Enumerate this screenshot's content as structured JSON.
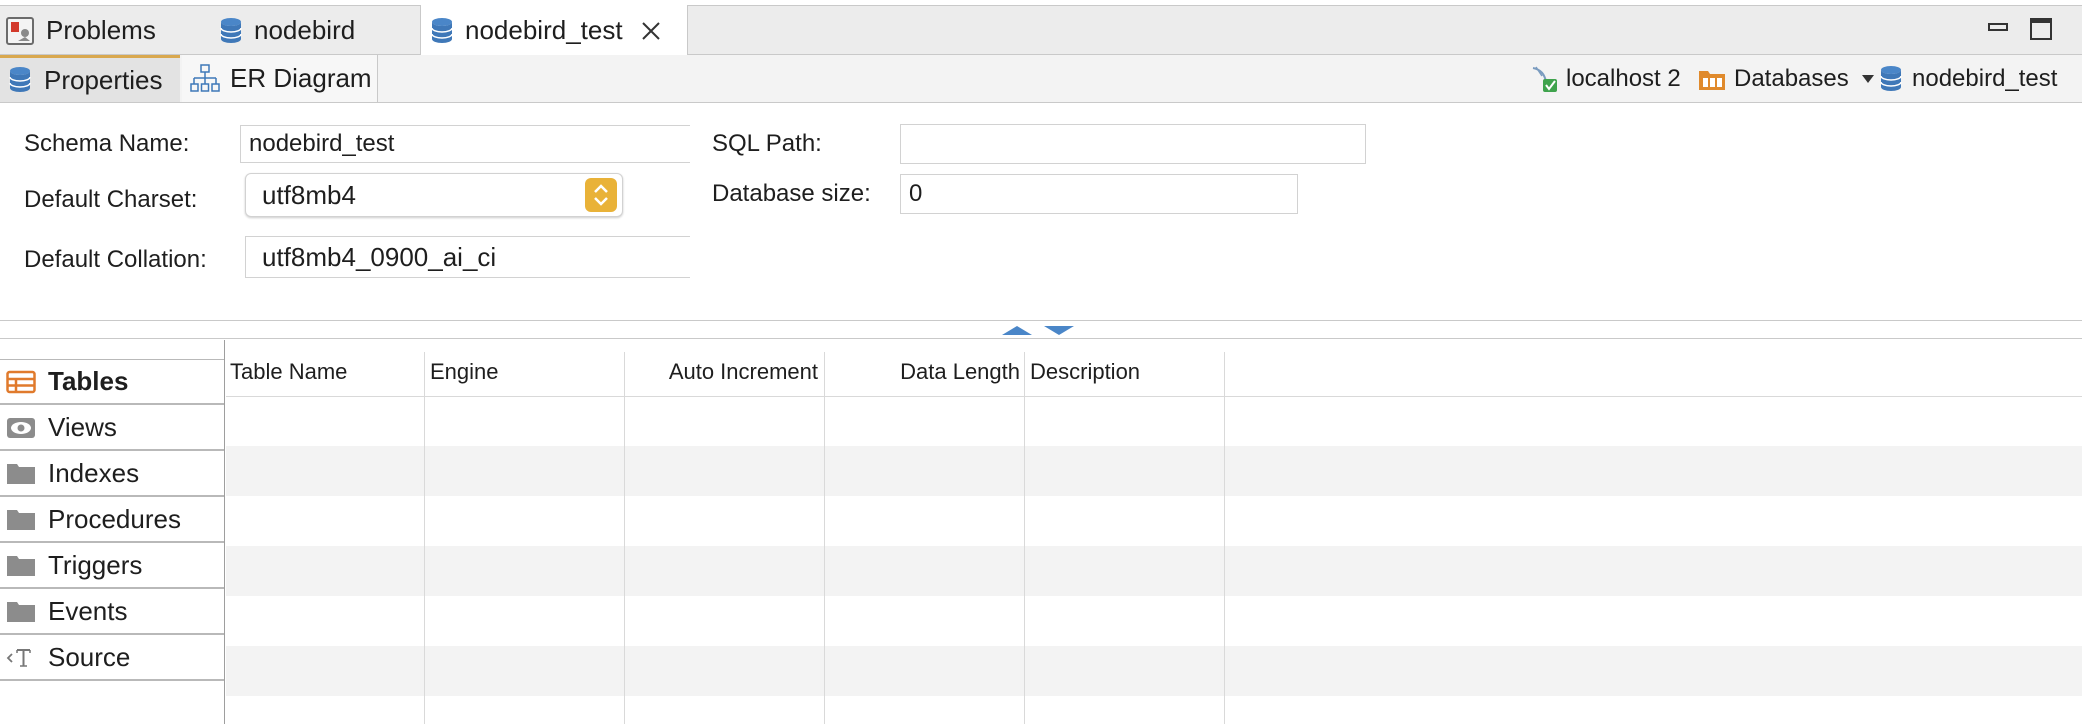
{
  "editor_tabs": [
    {
      "label": "Problems",
      "icon": "problems-icon",
      "active": false
    },
    {
      "label": "nodebird",
      "icon": "database-icon",
      "active": false
    },
    {
      "label": "nodebird_test",
      "icon": "database-icon",
      "active": true,
      "closable": true
    }
  ],
  "sub_tabs": [
    {
      "label": "Properties",
      "icon": "database-icon",
      "active": true
    },
    {
      "label": "ER Diagram",
      "icon": "er-diagram-icon",
      "active": false
    }
  ],
  "breadcrumb": {
    "server": "localhost 2",
    "databases": "Databases",
    "database": "nodebird_test"
  },
  "form": {
    "schema_name_label": "Schema Name:",
    "schema_name_value": "nodebird_test",
    "charset_label": "Default Charset:",
    "charset_value": "utf8mb4",
    "collation_label": "Default Collation:",
    "collation_value": "utf8mb4_0900_ai_ci",
    "sql_path_label": "SQL Path:",
    "sql_path_value": "",
    "db_size_label": "Database size:",
    "db_size_value": "0"
  },
  "nav": [
    {
      "label": "Tables",
      "icon": "table-icon",
      "active": true
    },
    {
      "label": "Views",
      "icon": "eye-icon",
      "active": false
    },
    {
      "label": "Indexes",
      "icon": "folder-icon",
      "active": false
    },
    {
      "label": "Procedures",
      "icon": "folder-icon",
      "active": false
    },
    {
      "label": "Triggers",
      "icon": "folder-icon",
      "active": false
    },
    {
      "label": "Events",
      "icon": "folder-icon",
      "active": false
    },
    {
      "label": "Source",
      "icon": "source-icon",
      "active": false
    }
  ],
  "table": {
    "columns": [
      "Table Name",
      "Engine",
      "Auto Increment",
      "Data Length",
      "Description"
    ],
    "rows": []
  },
  "colors": {
    "database_icon": "#4a86c8",
    "accent_orange": "#e08a2c",
    "stepper": "#e9b238",
    "folder": "#8c8c8c"
  }
}
